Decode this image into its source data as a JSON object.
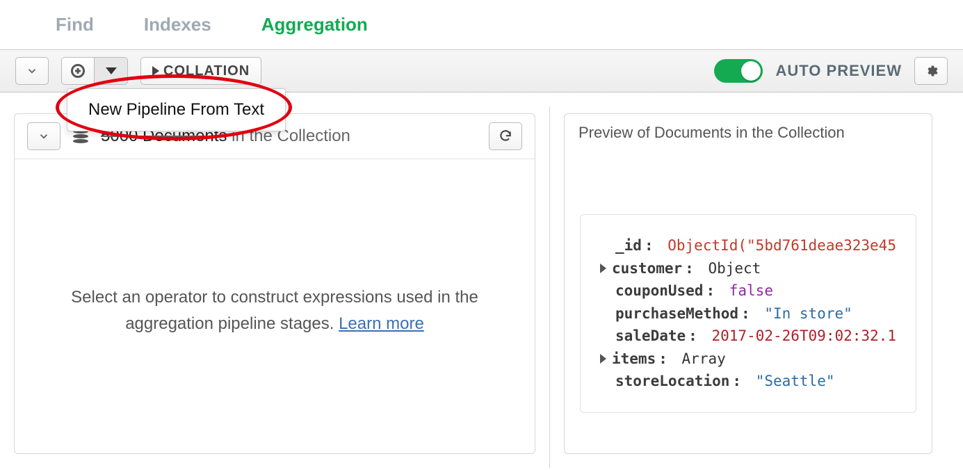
{
  "tabs": {
    "find": "Find",
    "indexes": "Indexes",
    "aggregation": "Aggregation"
  },
  "toolbar": {
    "collation_label": "COLLATION",
    "auto_preview_label": "AUTO PREVIEW",
    "dropdown": {
      "new_pipeline_from_text": "New Pipeline From Text"
    }
  },
  "left_panel": {
    "doc_count": "5000 Documents",
    "doc_count_suffix": " in the Collection",
    "hint_line1": "Select an operator to construct expressions used in the",
    "hint_line2_prefix": "aggregation pipeline stages. ",
    "learn_more": "Learn more"
  },
  "right_panel": {
    "header": "Preview of Documents in the Collection",
    "doc": {
      "id_key": "_id",
      "id_val": "ObjectId(\"5bd761deae323e45",
      "customer_key": "customer",
      "customer_val": "Object",
      "couponUsed_key": "couponUsed",
      "couponUsed_val": "false",
      "purchaseMethod_key": "purchaseMethod",
      "purchaseMethod_val": "\"In store\"",
      "saleDate_key": "saleDate",
      "saleDate_val": "2017-02-26T09:02:32.1",
      "items_key": "items",
      "items_val": "Array",
      "storeLocation_key": "storeLocation",
      "storeLocation_val": "\"Seattle\""
    }
  }
}
